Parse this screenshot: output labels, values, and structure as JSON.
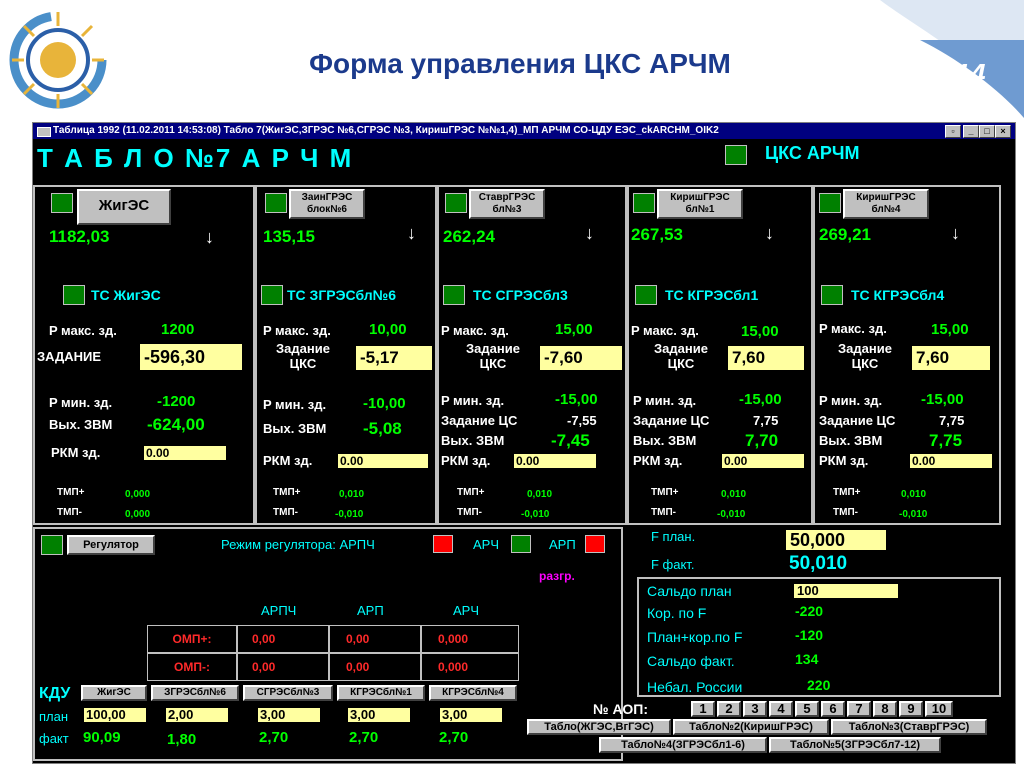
{
  "slide": {
    "title": "Форма управления ЦКС АРЧМ",
    "page_number": "14"
  },
  "window": {
    "title": "Таблица 1992   (11.02.2011 14:53:08) Табло 7(ЖигЭС,ЗГРЭС №6,СГРЭС №3, КиришГРЭС №№1,4)_МП АРЧМ СО-ЦДУ ЕЭС_ckARCHM_OIK2",
    "btn_restore": "▫",
    "btn_min": "_",
    "btn_max": "□",
    "btn_close": "×"
  },
  "header": {
    "board_title": "Т А Б Л О  №7  А Р Ч М",
    "cks_label": "ЦКС АРЧМ"
  },
  "stations": [
    {
      "name": "ЖигЭС",
      "power": "1182,03",
      "ts": "ТС  ЖигЭС",
      "pmax_label": "P макс. зд.",
      "pmax": "1200",
      "zad_label": "ЗАДАНИЕ",
      "zad": "-596,30",
      "pmin_label": "P мин. зд.",
      "pmin": "-1200",
      "zc_label": "",
      "zc": "",
      "zvm_label": "Вых. ЗВМ",
      "zvm": "-624,00",
      "rkm_label": "РКМ зд.",
      "rkm": "0.00",
      "tmp_plus_label": "ТМП+",
      "tmp_plus": "0,000",
      "tmp_minus_label": "ТМП-",
      "tmp_minus": "0,000"
    },
    {
      "name": "ЗаинГРЭС блок№6",
      "power": "135,15",
      "ts": "ТС ЗГРЭСбл№6",
      "pmax_label": "P макс. зд.",
      "pmax": "10,00",
      "zad_label": "Задание ЦКС",
      "zad": "-5,17",
      "pmin_label": "P мин. зд.",
      "pmin": "-10,00",
      "zc_label": "",
      "zc": "",
      "zvm_label": "Вых. ЗВМ",
      "zvm": "-5,08",
      "rkm_label": "РКМ зд.",
      "rkm": "0.00",
      "tmp_plus_label": "ТМП+",
      "tmp_plus": "0,010",
      "tmp_minus_label": "ТМП-",
      "tmp_minus": "-0,010"
    },
    {
      "name": "СтаврГРЭС бл№3",
      "power": "262,24",
      "ts": "ТС  СГРЭСбл3",
      "pmax_label": "P макс. зд.",
      "pmax": "15,00",
      "zad_label": "Задание ЦКС",
      "zad": "-7,60",
      "pmin_label": "P мин. зд.",
      "pmin": "-15,00",
      "zc_label": "Задание ЦС",
      "zc": "-7,55",
      "zvm_label": "Вых. ЗВМ",
      "zvm": "-7,45",
      "rkm_label": "РКМ зд.",
      "rkm": "0.00",
      "tmp_plus_label": "ТМП+",
      "tmp_plus": "0,010",
      "tmp_minus_label": "ТМП-",
      "tmp_minus": "-0,010"
    },
    {
      "name": "КиришГРЭС бл№1",
      "power": "267,53",
      "ts": "ТС  КГРЭСбл1",
      "pmax_label": "P макс. зд.",
      "pmax": "15,00",
      "zad_label": "Задание ЦКС",
      "zad": "7,60",
      "pmin_label": "P мин. зд.",
      "pmin": "-15,00",
      "zc_label": "Задание ЦС",
      "zc": "7,75",
      "zvm_label": "Вых. ЗВМ",
      "zvm": "7,70",
      "rkm_label": "РКМ зд.",
      "rkm": "0.00",
      "tmp_plus_label": "ТМП+",
      "tmp_plus": "0,010",
      "tmp_minus_label": "ТМП-",
      "tmp_minus": "-0,010"
    },
    {
      "name": "КиришГРЭС бл№4",
      "power": "269,21",
      "ts": "ТС  КГРЭСбл4",
      "pmax_label": "P макс. зд.",
      "pmax": "15,00",
      "zad_label": "Задание ЦКС",
      "zad": "7,60",
      "pmin_label": "P мин. зд.",
      "pmin": "-15,00",
      "zc_label": "Задание ЦС",
      "zc": "7,75",
      "zvm_label": "Вых. ЗВМ",
      "zvm": "7,75",
      "rkm_label": "РКМ зд.",
      "rkm": "0.00",
      "tmp_plus_label": "ТМП+",
      "tmp_plus": "0,010",
      "tmp_minus_label": "ТМП-",
      "tmp_minus": "-0,010"
    }
  ],
  "regulator": {
    "button": "Регулятор",
    "mode_label": "Режим регулятора: АРПЧ",
    "arch_label": "АРЧ",
    "arp_label": "АРП",
    "razgr": "разгр."
  },
  "omp_table": {
    "headers": [
      "АРПЧ",
      "АРП",
      "АРЧ"
    ],
    "rows": [
      {
        "label": "ОМП+:",
        "values": [
          "0,00",
          "0,00",
          "0,000"
        ]
      },
      {
        "label": "ОМП-:",
        "values": [
          "0,00",
          "0,00",
          "0,000"
        ]
      }
    ]
  },
  "kdu": {
    "title": "КДУ",
    "columns": [
      "ЖигЭС",
      "ЗГРЭСбл№6",
      "СГРЭСбл№3",
      "КГРЭСбл№1",
      "КГРЭСбл№4"
    ],
    "plan_label": "план",
    "plan": [
      "100,00",
      "2,00",
      "3,00",
      "3,00",
      "3,00"
    ],
    "fact_label": "факт",
    "fact": [
      "90,09",
      "1,80",
      "2,70",
      "2,70",
      "2,70"
    ]
  },
  "frequency": {
    "plan_label": "F план.",
    "plan": "50,000",
    "fact_label": "F факт.",
    "fact": "50,010"
  },
  "saldo": {
    "plan_label": "Сальдо план",
    "plan": "100",
    "korr_label": "Кор. по F",
    "korr": "-220",
    "plan_korr_label": "План+кор.по F",
    "plan_korr": "-120",
    "fact_label": "Сальдо факт.",
    "fact": "134",
    "nebal_label": "Небал. России",
    "nebal": "220"
  },
  "aop": {
    "label": "№ АОП:",
    "buttons": [
      "1",
      "2",
      "3",
      "4",
      "5",
      "6",
      "7",
      "8",
      "9",
      "10"
    ]
  },
  "nav_buttons": [
    "Табло(ЖГЭС,ВгГЭС)",
    "Табло№2(КиришГРЭС)",
    "Табло№3(СтаврГРЭС)",
    "Табло№4(ЗГРЭСбл1-6)",
    "Табло№5(ЗГРЭСбл7-12)"
  ],
  "colors": {
    "window_bg": "#000000",
    "value_green": "#00ff00",
    "label_cyan": "#00ffff",
    "input_yellow": "#ffffa0",
    "status_green": "#008000",
    "status_red": "#ff0000",
    "slide_title": "#1b3a8c"
  }
}
